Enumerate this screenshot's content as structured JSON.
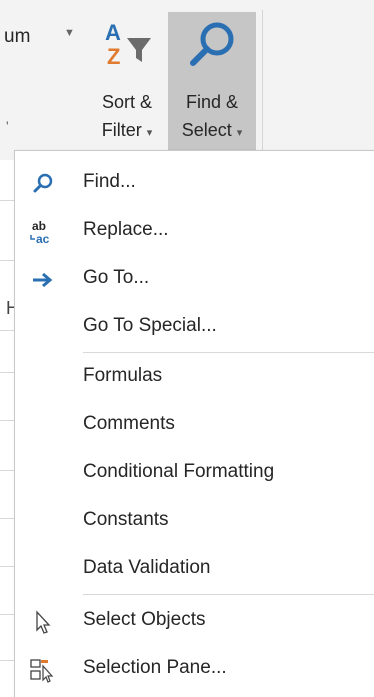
{
  "ribbon": {
    "sum_text": "um",
    "sum_caret": "▼",
    "left_tick": "'",
    "sort_filter": {
      "line1": "Sort &",
      "line2": "Filter",
      "caret": "▾",
      "icon": "sort-filter-icon"
    },
    "find_select": {
      "line1": "Find &",
      "line2": "Select",
      "caret": "▾",
      "icon": "magnifier-icon",
      "active": true
    }
  },
  "sheet": {
    "col_label": "H"
  },
  "menu": {
    "items": [
      {
        "label": "Find...",
        "icon": "magnifier-icon"
      },
      {
        "label": "Replace...",
        "icon": "replace-icon"
      },
      {
        "label": "Go To...",
        "icon": "arrow-right-icon"
      },
      {
        "label": "Go To Special...",
        "icon": ""
      },
      {
        "label": "Formulas",
        "icon": ""
      },
      {
        "label": "Comments",
        "icon": ""
      },
      {
        "label": "Conditional Formatting",
        "icon": ""
      },
      {
        "label": "Constants",
        "icon": ""
      },
      {
        "label": "Data Validation",
        "icon": ""
      },
      {
        "label": "Select Objects",
        "icon": "cursor-arrow-icon"
      },
      {
        "label": "Selection Pane...",
        "icon": "selection-pane-icon"
      }
    ]
  },
  "colors": {
    "accent_blue": "#2b6fb3",
    "ribbon_bg": "#f3f3f3",
    "active_button_bg": "#c6c6c6",
    "sort_orange": "#e07a2e",
    "text": "#262626"
  }
}
